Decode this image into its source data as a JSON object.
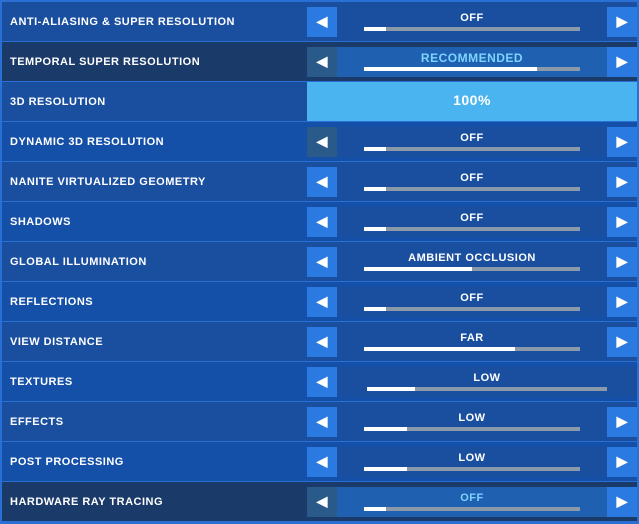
{
  "rows": [
    {
      "id": "anti-aliasing",
      "label": "ANTI-ALIASING & SUPER RESOLUTION",
      "value": "OFF",
      "barFill": 10,
      "type": "normal",
      "leftArrowDark": false,
      "rightArrowDark": false
    },
    {
      "id": "temporal-super-resolution",
      "label": "TEMPORAL SUPER RESOLUTION",
      "value": "RECOMMENDED",
      "barFill": 80,
      "type": "tsr",
      "leftArrowDark": true,
      "rightArrowDark": false
    },
    {
      "id": "3d-resolution",
      "label": "3D RESOLUTION",
      "value": "100%",
      "barFill": 100,
      "type": "resolution",
      "leftArrowDark": false,
      "rightArrowDark": false
    },
    {
      "id": "dynamic-3d-resolution",
      "label": "DYNAMIC 3D RESOLUTION",
      "value": "OFF",
      "barFill": 10,
      "type": "normal",
      "leftArrowDark": true,
      "rightArrowDark": false
    },
    {
      "id": "nanite",
      "label": "NANITE VIRTUALIZED GEOMETRY",
      "value": "OFF",
      "barFill": 10,
      "type": "normal",
      "leftArrowDark": false,
      "rightArrowDark": false
    },
    {
      "id": "shadows",
      "label": "SHADOWS",
      "value": "OFF",
      "barFill": 10,
      "type": "normal",
      "leftArrowDark": false,
      "rightArrowDark": false
    },
    {
      "id": "global-illumination",
      "label": "GLOBAL ILLUMINATION",
      "value": "AMBIENT OCCLUSION",
      "barFill": 50,
      "type": "normal",
      "leftArrowDark": false,
      "rightArrowDark": false
    },
    {
      "id": "reflections",
      "label": "REFLECTIONS",
      "value": "OFF",
      "barFill": 10,
      "type": "normal",
      "leftArrowDark": false,
      "rightArrowDark": false
    },
    {
      "id": "view-distance",
      "label": "VIEW DISTANCE",
      "value": "FAR",
      "barFill": 70,
      "type": "normal",
      "leftArrowDark": false,
      "rightArrowDark": false
    },
    {
      "id": "textures",
      "label": "TEXTURES",
      "value": "LOW",
      "barFill": 20,
      "type": "no-right-arrow",
      "leftArrowDark": false,
      "rightArrowDark": false
    },
    {
      "id": "effects",
      "label": "EFFECTS",
      "value": "LOW",
      "barFill": 20,
      "type": "normal",
      "leftArrowDark": false,
      "rightArrowDark": false
    },
    {
      "id": "post-processing",
      "label": "POST PROCESSING",
      "value": "LOW",
      "barFill": 20,
      "type": "normal",
      "leftArrowDark": false,
      "rightArrowDark": false
    },
    {
      "id": "hardware-ray-tracing",
      "label": "HARDWARE RAY TRACING",
      "value": "OFF",
      "barFill": 10,
      "type": "tsr",
      "leftArrowDark": true,
      "rightArrowDark": false
    }
  ],
  "icons": {
    "left_arrow": "◀",
    "right_arrow": "▶"
  }
}
